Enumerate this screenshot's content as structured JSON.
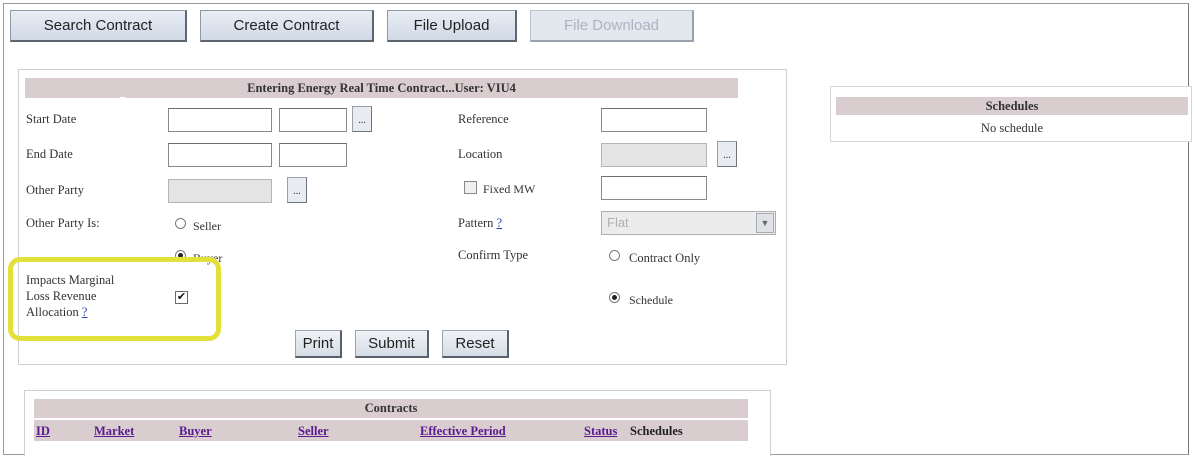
{
  "toolbar": {
    "search_contract": "Search Contract",
    "create_contract": "Create Contract",
    "file_upload": "File Upload",
    "file_download": "File Download"
  },
  "form": {
    "header": "Entering Energy Real Time Contract...User: VIU4",
    "start_date_label": "Start Date",
    "end_date_label": "End Date",
    "other_party_label": "Other Party",
    "other_party_is_label": "Other Party Is:",
    "seller_label": "Seller",
    "buyer_label": "Buyer",
    "buyer_selected": true,
    "impacts_label_1": "Impacts Marginal",
    "impacts_label_2": "Loss Revenue",
    "impacts_label_3": "Allocation",
    "impacts_checked": true,
    "help_mark": "?",
    "reference_label": "Reference",
    "location_label": "Location",
    "fixed_mw_label": "Fixed MW",
    "pattern_label": "Pattern",
    "pattern_value": "Flat",
    "confirm_type_label": "Confirm Type",
    "contract_only_label": "Contract Only",
    "schedule_label": "Schedule",
    "confirm_type_selected": "Schedule",
    "ellipsis": "...",
    "print": "Print",
    "submit": "Submit",
    "reset": "Reset"
  },
  "schedules": {
    "header": "Schedules",
    "empty": "No schedule"
  },
  "contracts": {
    "header": "Contracts",
    "columns": [
      "ID",
      "Market",
      "Buyer",
      "Seller",
      "Effective Period",
      "Status",
      "Schedules"
    ]
  },
  "colors": {
    "header_bg": "#d9cdd0",
    "highlight": "#e3e03a",
    "link": "#5b1b8f"
  }
}
